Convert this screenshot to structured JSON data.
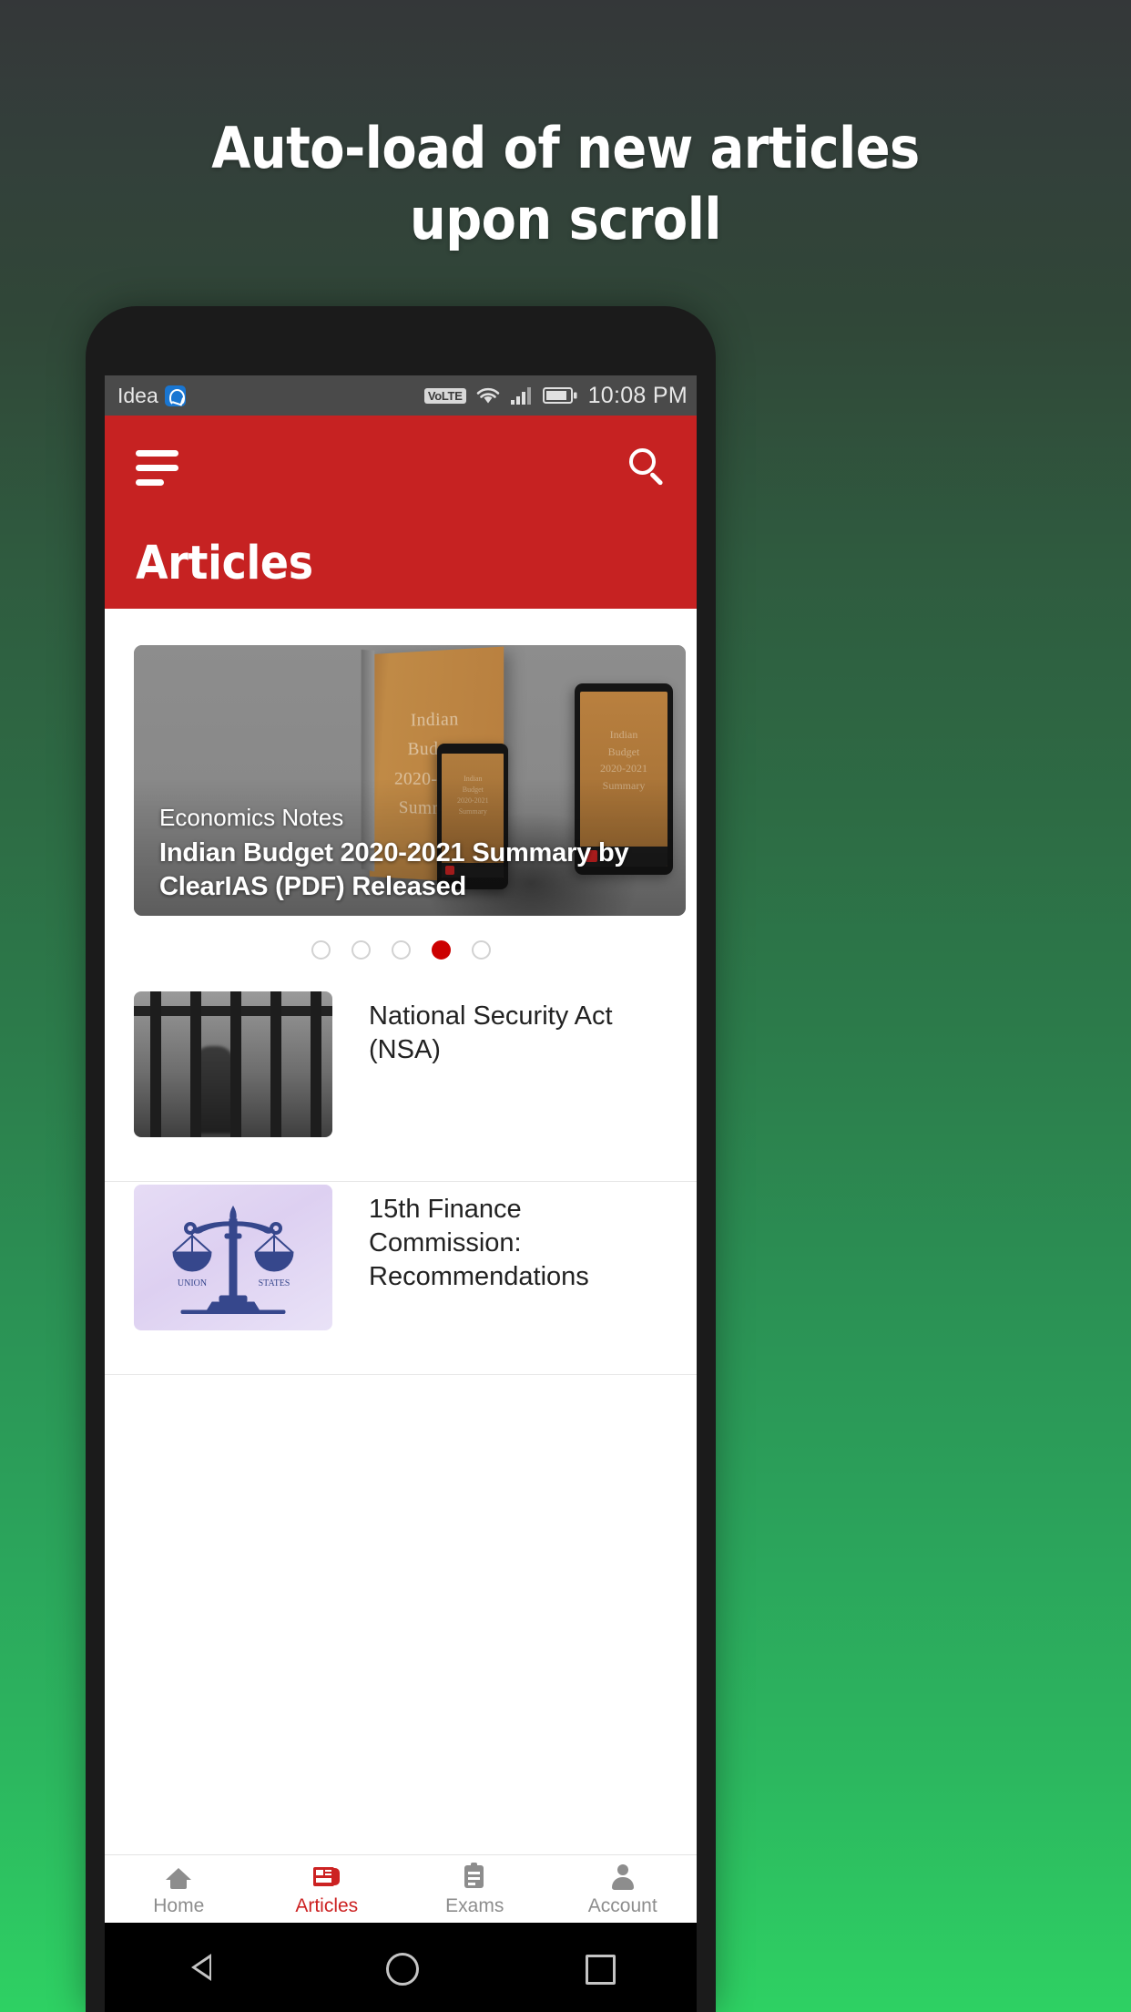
{
  "promo": {
    "line1": "Auto-load of new articles",
    "line2": "upon scroll"
  },
  "statusbar": {
    "carrier": "Idea",
    "carrier_icon": "idea-logo-icon",
    "volte": "VoLTE",
    "wifi_icon": "wifi-icon",
    "signal_icon": "signal-bars-icon",
    "battery_icon": "battery-icon",
    "time": "10:08 PM"
  },
  "appbar": {
    "menu_icon": "hamburger-menu-icon",
    "search_icon": "search-icon",
    "title": "Articles",
    "background_color": "#c62222"
  },
  "hero": {
    "category": "Economics Notes",
    "title": "Indian Budget 2020-2021 Summary by ClearIAS (PDF) Released",
    "book_cover_lines": [
      "Indian",
      "Budget",
      "2020-2021",
      "Summary"
    ],
    "device_lines": [
      "Indian",
      "Budget",
      "2020-2021",
      "Summary"
    ]
  },
  "carousel": {
    "total": 5,
    "active_index": 3,
    "active_color": "#cc0000",
    "inactive_color": "#d2d2d2"
  },
  "articles": [
    {
      "title": "National Security Act (NSA)",
      "thumb": "prison-bars-photo"
    },
    {
      "title": "15th Finance Commission: Recommendations",
      "thumb": "balance-scales-illustration",
      "scale_labels": [
        "UNION",
        "STATES"
      ]
    }
  ],
  "bottomnav": {
    "active_color": "#cc2222",
    "inactive_color": "#8d8d8d",
    "items": [
      {
        "label": "Home",
        "icon": "home-icon",
        "active": false
      },
      {
        "label": "Articles",
        "icon": "newspaper-icon",
        "active": true
      },
      {
        "label": "Exams",
        "icon": "clipboard-icon",
        "active": false
      },
      {
        "label": "Account",
        "icon": "person-icon",
        "active": false
      }
    ]
  },
  "androidnav": {
    "back_icon": "back-triangle-icon",
    "home_icon": "home-circle-icon",
    "recents_icon": "recents-square-icon"
  }
}
